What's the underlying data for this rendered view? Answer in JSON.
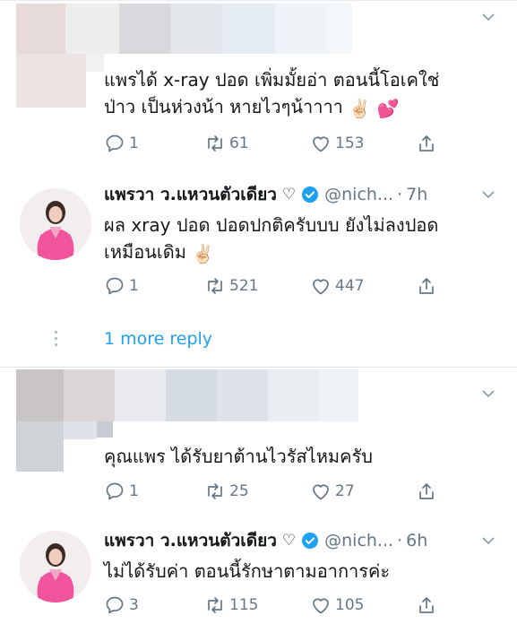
{
  "tweets": [
    {
      "kind": "reply",
      "avatar": "pixelated-avatar",
      "lines": [
        "แพรได้ x-ray ปอด เพิ่มมั้ยอ่า ตอนนี้โอเคใช่",
        "ป่าว เป็นห่วงน้า หายไวๆน้าาาา"
      ],
      "emoji": [
        "✌🏻",
        "💕"
      ],
      "reply_count": "1",
      "retweet_count": "61",
      "like_count": "153"
    },
    {
      "kind": "author",
      "name": "แพรวา ว.แหวนตัวเดียว",
      "heart": "♡",
      "handle": "@nich...",
      "dot": "·",
      "time": "7h",
      "lines": [
        "ผล xray ปอด ปอดปกติครับบบ ยังไม่ลงปอด",
        "เหมือนเดิม"
      ],
      "emoji": [
        "✌🏻"
      ],
      "reply_count": "1",
      "retweet_count": "521",
      "like_count": "447"
    },
    {
      "kind": "reply",
      "avatar": "pixelated-avatar",
      "lines": [
        "คุณแพร ได้รับยาต้านไวรัสไหมครับ"
      ],
      "reply_count": "1",
      "retweet_count": "25",
      "like_count": "27"
    },
    {
      "kind": "author",
      "name": "แพรวา ว.แหวนตัวเดียว",
      "heart": "♡",
      "handle": "@nich...",
      "dot": "·",
      "time": "6h",
      "lines": [
        "ไม่ได้รับค่า ตอนนี้รักษาตามอาการค่ะ"
      ],
      "reply_count": "3",
      "retweet_count": "115",
      "like_count": "105"
    }
  ],
  "more_replies": "1 more reply",
  "colors": {
    "accent": "#1da1f2",
    "secondary_text": "#657786",
    "avatar_dress": "#f0549c"
  },
  "icons": [
    "reply-icon",
    "retweet-icon",
    "like-icon",
    "share-icon",
    "verified-badge-icon",
    "chevron-down-icon"
  ]
}
